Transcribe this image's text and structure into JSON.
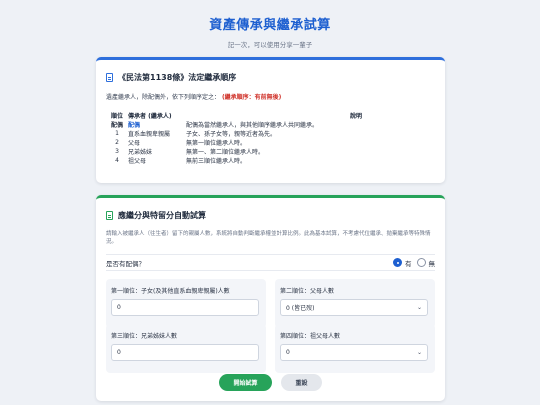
{
  "header": {
    "title": "資產傳承與繼承試算",
    "subtitle": "記一次，可以使用分享一輩子"
  },
  "law": {
    "title": "《民法第1138條》法定繼承順序",
    "intro": "遺產繼承人，除配偶外，依下列順序定之：",
    "warning": "(繼承順序：有前無後)",
    "headers": {
      "order": "順位",
      "heir": "傳承者 (繼承人)",
      "desc": "說明"
    },
    "rows": [
      {
        "order": "配偶",
        "heir": "配偶",
        "desc": "配偶為當然繼承人，與其他順序繼承人共同繼承。"
      },
      {
        "order": "1",
        "heir": "直系血親卑親屬",
        "desc": "子女、孫子女等，親等近者為先。"
      },
      {
        "order": "2",
        "heir": "父母",
        "desc": "無第一順位繼承人時。"
      },
      {
        "order": "3",
        "heir": "兄弟姊妹",
        "desc": "無第一、第二順位繼承人時。"
      },
      {
        "order": "4",
        "heir": "祖父母",
        "desc": "無前三順位繼承人時。"
      }
    ]
  },
  "calc": {
    "title": "應繼分與特留分自動試算",
    "intro": "請輸入被繼承人（往生者）留下的親屬人數，系統將自動判斷繼承權並計算比例。此為基本試算，不考慮代位繼承、拋棄繼承等特殊情況。",
    "spouse_label": "是否有配偶？",
    "spouse_yes": "有",
    "spouse_no": "無",
    "field1_label": "第一順位：子女(及其他直系血親卑親屬)人數",
    "field1_value": "0",
    "field2_label": "第二順位：父母人數",
    "field2_value": "0 (皆已歿)",
    "field3_label": "第三順位：兄弟姊妹人數",
    "field3_value": "0",
    "field4_label": "第四順位：祖父母人數",
    "field4_value": "0",
    "calc_button": "開始試算",
    "reset_button": "重設"
  }
}
